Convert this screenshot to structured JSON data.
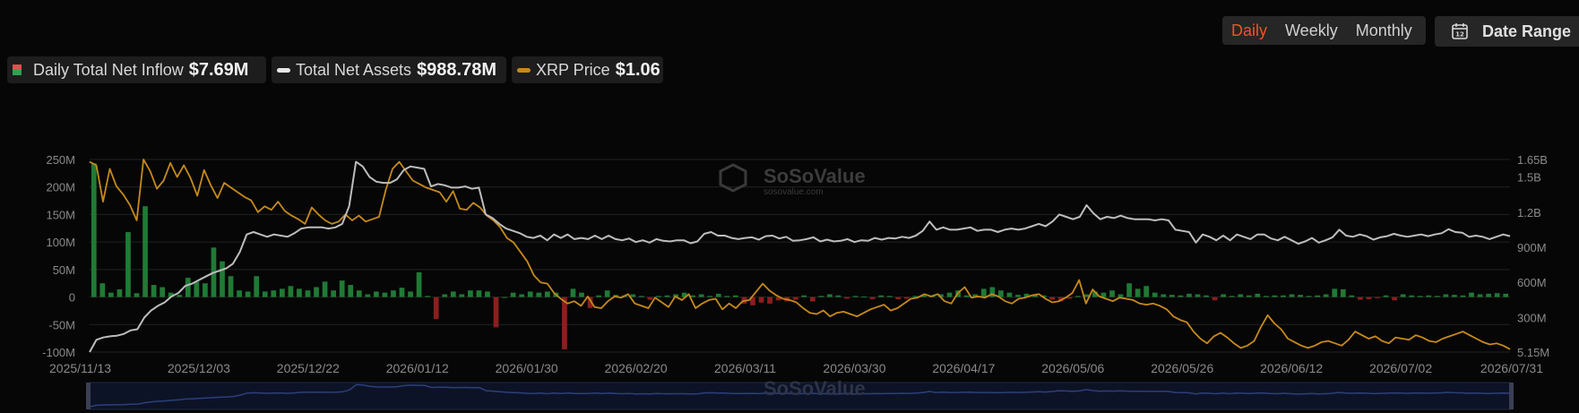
{
  "controls": {
    "periods": [
      "Daily",
      "Weekly",
      "Monthly"
    ],
    "active_period": "Daily",
    "date_range_label": "Date Range",
    "accent_color": "#f0502c"
  },
  "legend": {
    "inflow": {
      "label": "Daily Total Net Inflow",
      "value": "$7.69M"
    },
    "assets": {
      "label": "Total Net Assets",
      "value": "$988.78M",
      "color": "#e6e6e6"
    },
    "price": {
      "label": "XRP Price",
      "value": "$1.06",
      "color": "#c68a1a"
    }
  },
  "watermark": {
    "brand": "SoSoValue",
    "url": "sosovalue.com"
  },
  "chart_data": {
    "type": "bar+line",
    "x_ticks": [
      "2025/11/13",
      "2025/12/03",
      "2025/12/22",
      "2026/01/12",
      "2026/01/30",
      "2026/02/20",
      "2026/03/11",
      "2026/03/30",
      "2026/04/17",
      "2026/05/06",
      "2026/05/26",
      "2026/06/12",
      "2026/07/02",
      "2026/07/31"
    ],
    "y_left_ticks": [
      "250M",
      "200M",
      "150M",
      "100M",
      "50M",
      "0",
      "-50M",
      "-100M"
    ],
    "y_left_range": [
      -100,
      250
    ],
    "y_right_ticks": [
      "1.65B",
      "1.5B",
      "1.2B",
      "900M",
      "600M",
      "300M",
      "5.15M"
    ],
    "y_right_range": [
      5.15,
      1650
    ],
    "grid": true,
    "positive_color": "#1f7a35",
    "negative_color": "#8a1f1f",
    "series": [
      {
        "name": "Daily Total Net Inflow",
        "kind": "bar",
        "unit": "M",
        "values": [
          243,
          25,
          8,
          14,
          118,
          7,
          165,
          22,
          18,
          8,
          4,
          35,
          28,
          25,
          90,
          65,
          38,
          12,
          10,
          38,
          10,
          12,
          15,
          20,
          15,
          12,
          18,
          28,
          12,
          30,
          22,
          12,
          5,
          10,
          8,
          12,
          17,
          10,
          45,
          2,
          -40,
          5,
          10,
          5,
          12,
          12,
          10,
          -55,
          0,
          8,
          5,
          10,
          8,
          10,
          8,
          -95,
          15,
          8,
          -20,
          3,
          12,
          4,
          3,
          5,
          2,
          -5,
          2,
          3,
          5,
          8,
          3,
          5,
          2,
          6,
          2,
          3,
          -12,
          -15,
          -10,
          -12,
          -6,
          -8,
          -5,
          3,
          -8,
          2,
          5,
          3,
          -3,
          2,
          1,
          -4,
          3,
          2,
          -4,
          -3,
          2,
          3,
          2,
          5,
          8,
          12,
          3,
          5,
          15,
          18,
          12,
          8,
          4,
          6,
          5,
          3,
          -5,
          -8,
          -3,
          2,
          5,
          10,
          8,
          12,
          5,
          25,
          15,
          20,
          8,
          5,
          4,
          3,
          6,
          5,
          3,
          -6,
          5,
          2,
          5,
          3,
          6,
          2,
          3,
          3,
          5,
          4,
          2,
          3,
          5,
          15,
          14,
          3,
          -5,
          -4,
          -2,
          3,
          -6,
          5,
          3,
          2,
          3,
          2,
          5,
          4,
          3,
          8,
          5,
          6,
          7,
          6
        ]
      },
      {
        "name": "Total Net Assets",
        "kind": "line",
        "unit": "M",
        "values": [
          5,
          110,
          130,
          140,
          145,
          160,
          190,
          200,
          300,
          360,
          400,
          430,
          480,
          510,
          570,
          590,
          620,
          650,
          680,
          700,
          720,
          760,
          860,
          1010,
          1030,
          1010,
          990,
          1010,
          1000,
          990,
          1020,
          1060,
          1070,
          1070,
          1070,
          1060,
          1070,
          1100,
          1250,
          1630,
          1590,
          1500,
          1460,
          1450,
          1450,
          1480,
          1560,
          1590,
          1580,
          1570,
          1420,
          1440,
          1430,
          1410,
          1410,
          1420,
          1400,
          1410,
          1180,
          1150,
          1100,
          1060,
          1040,
          1020,
          990,
          980,
          1000,
          960,
          1010,
          980,
          1010,
          970,
          980,
          970,
          1000,
          970,
          1000,
          970,
          960,
          975,
          945,
          960,
          940,
          970,
          955,
          950,
          960,
          960,
          935,
          950,
          1015,
          1030,
          1000,
          1000,
          980,
          970,
          980,
          985,
          965,
          995,
          1000,
          975,
          990,
          955,
          960,
          970,
          985,
          950,
          965,
          950,
          955,
          970,
          945,
          960,
          955,
          980,
          965,
          980,
          975,
          990,
          980,
          1000,
          1040,
          1120,
          1050,
          1070,
          1050,
          1050,
          1060,
          1070,
          1040,
          1050,
          1050,
          1030,
          1050,
          1060,
          1050,
          1060,
          1080,
          1100,
          1080,
          1120,
          1180,
          1160,
          1140,
          1160,
          1260,
          1190,
          1140,
          1160,
          1150,
          1170,
          1150,
          1140,
          1140,
          1140,
          1130,
          1140,
          1130,
          1050,
          1040,
          1030,
          940,
          1010,
          990,
          960,
          1000,
          960,
          1010,
          990,
          970,
          1010,
          1010,
          975,
          960,
          990,
          960,
          930,
          950,
          980,
          940,
          960,
          985,
          1050,
          1000,
          990,
          1010,
          995,
          965,
          985,
          995,
          1015,
          1000,
          990,
          1000,
          1010,
          995,
          1010,
          1020,
          1055,
          1030,
          1025,
          990,
          1000,
          990,
          970,
          990,
          1010,
          995
        ]
      },
      {
        "name": "XRP Price",
        "kind": "line",
        "unit": "M (right-axis scale)",
        "values": [
          1630,
          1600,
          1290,
          1570,
          1420,
          1350,
          1260,
          1130,
          1650,
          1550,
          1400,
          1470,
          1620,
          1500,
          1600,
          1490,
          1340,
          1560,
          1430,
          1320,
          1450,
          1410,
          1370,
          1330,
          1300,
          1200,
          1250,
          1220,
          1290,
          1210,
          1170,
          1140,
          1100,
          1240,
          1180,
          1130,
          1100,
          1120,
          1180,
          1130,
          1170,
          1120,
          1140,
          1160,
          1390,
          1570,
          1630,
          1550,
          1470,
          1440,
          1410,
          1390,
          1370,
          1290,
          1380,
          1230,
          1220,
          1280,
          1240,
          1170,
          1130,
          1070,
          980,
          940,
          860,
          780,
          660,
          600,
          590,
          510,
          460,
          420,
          440,
          400,
          480,
          390,
          380,
          440,
          480,
          470,
          500,
          420,
          400,
          380,
          470,
          430,
          390,
          480,
          450,
          500,
          380,
          420,
          450,
          460,
          370,
          420,
          380,
          440,
          450,
          520,
          590,
          530,
          490,
          460,
          450,
          430,
          380,
          340,
          330,
          360,
          310,
          340,
          350,
          330,
          310,
          340,
          370,
          390,
          410,
          360,
          380,
          420,
          460,
          470,
          500,
          480,
          500,
          440,
          420,
          510,
          560,
          470,
          480,
          470,
          500,
          480,
          440,
          420,
          460,
          470,
          490,
          500,
          460,
          430,
          440,
          470,
          510,
          620,
          420,
          540,
          480,
          460,
          440,
          470,
          460,
          450,
          420,
          410,
          420,
          400,
          370,
          310,
          280,
          260,
          180,
          120,
          80,
          140,
          170,
          130,
          80,
          40,
          60,
          100,
          220,
          320,
          250,
          200,
          120,
          90,
          60,
          40,
          60,
          90,
          100,
          80,
          60,
          110,
          180,
          150,
          120,
          140,
          100,
          80,
          130,
          120,
          110,
          150,
          130,
          100,
          90,
          120,
          140,
          160,
          180,
          150,
          120,
          90,
          70,
          80,
          60,
          30
        ]
      }
    ]
  }
}
